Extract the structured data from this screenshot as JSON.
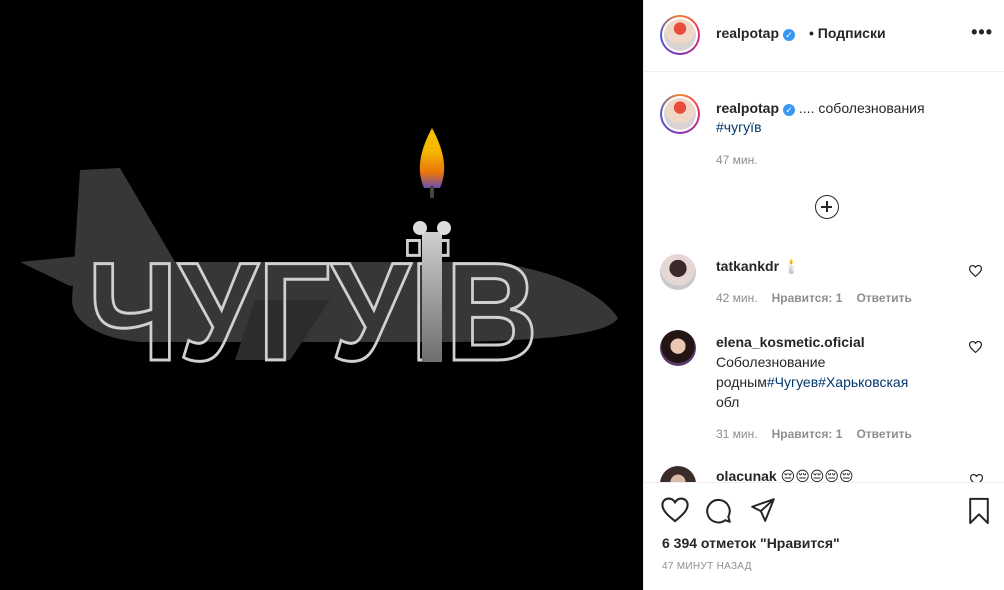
{
  "post": {
    "image_text": "ЧУГУЇВ",
    "colors": {
      "image_bg": "#000000",
      "plane": "#3a3a3a",
      "flame_top": "#f5b400",
      "flame_mid": "#e8740c",
      "flame_base": "#6a4fb5"
    }
  },
  "header": {
    "username": "realpotap",
    "follow_label": "• Подписки",
    "more_icon": "more-horizontal-icon"
  },
  "caption": {
    "username": "realpotap",
    "text": ".... соболезнования",
    "hashtag": "#чугуїв",
    "time": "47 мин."
  },
  "comments": [
    {
      "username": "tatkankdr",
      "text": "🕯️",
      "time": "42 мин.",
      "likes": "Нравится: 1",
      "reply": "Ответить"
    },
    {
      "username": "elena_kosmetic.oficial",
      "text_lines": [
        "Соболезнование",
        "родным",
        "#Чугуев",
        "#Харьковская",
        "обл"
      ],
      "time": "31 мин.",
      "likes": "Нравится: 1",
      "reply": "Ответить"
    },
    {
      "username": "olacunak",
      "text": "😔😔😔😔😔"
    }
  ],
  "footer": {
    "likes_text": "6 394 отметок \"Нравится\"",
    "posted_ago": "47 МИНУТ НАЗАД"
  },
  "icons": [
    "heart-icon",
    "comment-icon",
    "share-icon",
    "bookmark-icon",
    "add-comment-icon",
    "verified-badge-icon"
  ]
}
